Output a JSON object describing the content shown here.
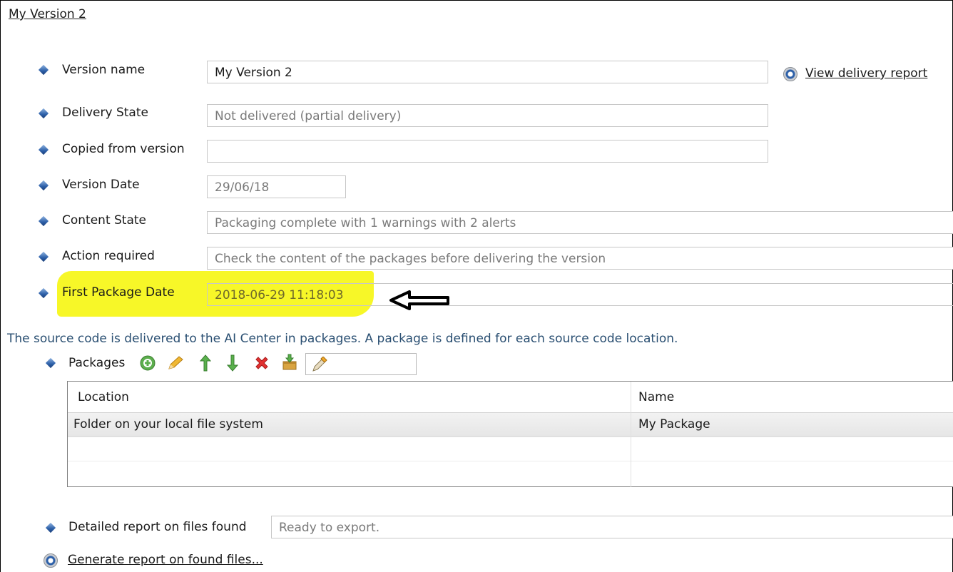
{
  "page": {
    "title": "My Version 2"
  },
  "form": {
    "version_name": {
      "label": "Version name",
      "value": "My Version 2"
    },
    "delivery_state": {
      "label": "Delivery State",
      "value": "Not delivered (partial delivery)"
    },
    "copied_from": {
      "label": "Copied from version",
      "value": ""
    },
    "version_date": {
      "label": "Version Date",
      "value": "29/06/18"
    },
    "content_state": {
      "label": "Content State",
      "value": "Packaging complete with 1 warnings with 2 alerts"
    },
    "action_required": {
      "label": "Action required",
      "value": "Check the content of the packages before delivering the version"
    },
    "first_package_date": {
      "label": "First Package Date",
      "value": "2018-06-29 11:18:03"
    }
  },
  "links": {
    "view_delivery_report": "View delivery report",
    "generate_report": "Generate report on found files..."
  },
  "info_text": "The source code is delivered to the AI Center in packages. A package is defined for each source code location.",
  "packages": {
    "label": "Packages",
    "toolbar_icons": [
      "add-icon",
      "edit-pencil-icon",
      "move-up-icon",
      "move-down-icon",
      "delete-icon",
      "import-icon",
      "pick-icon"
    ],
    "columns": [
      "Location",
      "Name"
    ],
    "rows": [
      {
        "location": "Folder on your local file system",
        "name": "My Package"
      }
    ]
  },
  "report": {
    "label": "Detailed report on files found",
    "value": "Ready to export."
  },
  "colors": {
    "highlight": "#f7f71c",
    "info_text": "#2a4f72",
    "diamond": "#2c5fa8"
  }
}
